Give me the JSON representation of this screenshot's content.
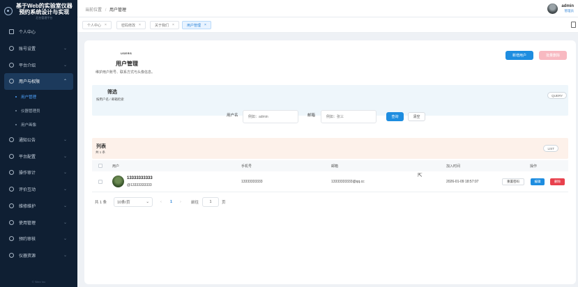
{
  "app": {
    "title_line1": "基于Web的实验室仪器",
    "title_line2": "预约系统设计与实现",
    "subtitle": "后台管理平台"
  },
  "sidebar": {
    "items": [
      {
        "label": "个人中心",
        "icon": "user-square-icon",
        "expandable": false
      },
      {
        "label": "账号设置",
        "icon": "circle-icon",
        "expandable": true
      },
      {
        "label": "平台介绍",
        "icon": "circle-icon",
        "expandable": true
      },
      {
        "label": "用户与权限",
        "icon": "circle-icon",
        "expandable": true,
        "active": true
      },
      {
        "label": "通知公告",
        "icon": "circle-icon",
        "expandable": true
      },
      {
        "label": "平台配置",
        "icon": "circle-icon",
        "expandable": true
      },
      {
        "label": "操作审计",
        "icon": "circle-icon",
        "expandable": true
      },
      {
        "label": "评价互动",
        "icon": "circle-icon",
        "expandable": true
      },
      {
        "label": "维修维护",
        "icon": "circle-icon",
        "expandable": true
      },
      {
        "label": "使用管理",
        "icon": "circle-icon",
        "expandable": true
      },
      {
        "label": "预约审核",
        "icon": "circle-icon",
        "expandable": true
      },
      {
        "label": "仪器资源",
        "icon": "circle-icon",
        "expandable": true
      }
    ],
    "submenu": [
      {
        "label": "用户管理",
        "active": true
      },
      {
        "label": "仪器管理员"
      },
      {
        "label": "用户画像"
      }
    ],
    "footer": "© Sitev Inc"
  },
  "header": {
    "breadcrumb_home": "当前位置",
    "breadcrumb_sep": "/",
    "breadcrumb_current": "用户管理",
    "user_name": "admin",
    "user_role": "管理员"
  },
  "tabs": [
    {
      "label": "个人中心",
      "close": "×"
    },
    {
      "label": "密码修改",
      "close": "×"
    },
    {
      "label": "关于我们",
      "close": "×"
    },
    {
      "label": "用户管理",
      "close": "×",
      "active": true
    }
  ],
  "page": {
    "eyebrow": "USERS",
    "title": "用户管理",
    "description": "维护用户账号、联系方式与头像信息。",
    "add_button": "新增用户",
    "batch_delete_button": "批量删除"
  },
  "filter": {
    "title": "筛选",
    "subtitle": "按用户名 / 邮箱检索",
    "badge": "QUERY",
    "username_label": "用户名",
    "username_placeholder": "例如：admin",
    "email_label": "邮箱",
    "email_placeholder": "例如：张三",
    "search_button": "查询",
    "clear_button": "清空"
  },
  "list": {
    "title": "列表",
    "count_text": "共 1 条",
    "badge": "LIST",
    "columns": [
      "用户",
      "手机号",
      "邮箱",
      "加入时间",
      "操作"
    ],
    "rows": [
      {
        "name": "13333333333",
        "handle": "@13333333333",
        "phone": "13333333333",
        "email": "13333333333@qq.cc",
        "joined": "2026-01-09 18:57:07",
        "actions": [
          "重置密码",
          "编辑",
          "删除"
        ]
      }
    ]
  },
  "pagination": {
    "total": "共 1 条",
    "page_size": "10条/页",
    "prev": "‹",
    "current": "1",
    "next": "›",
    "goto_label": "前往",
    "goto_value": "1",
    "goto_suffix": "页"
  },
  "colors": {
    "sidebar_bg": "#0f1f33",
    "primary": "#1e8de0",
    "danger": "#e8414d",
    "filter_bg": "#eef6fb",
    "list_bg": "#fdf1ea"
  }
}
